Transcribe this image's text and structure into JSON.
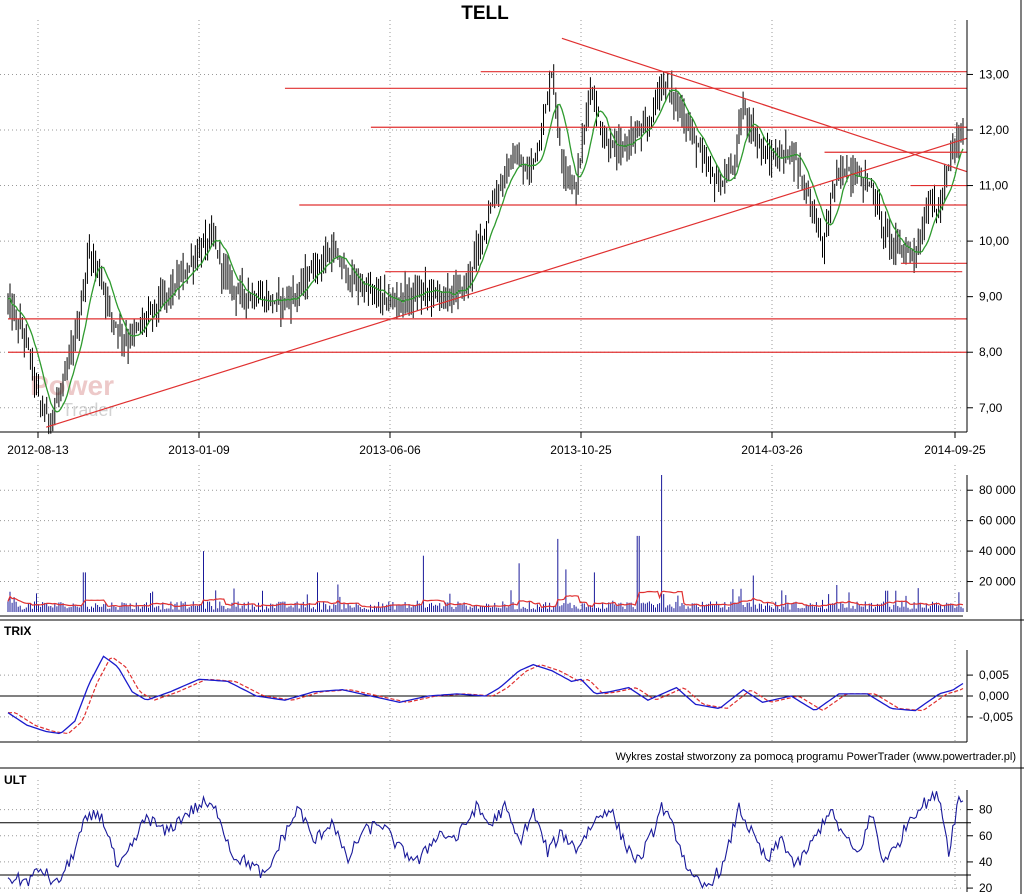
{
  "chart_data": [
    {
      "type": "candlestick",
      "title": "TELL",
      "x_ticks": [
        "2012-08-13",
        "2013-01-09",
        "2013-06-06",
        "2013-10-25",
        "2014-03-26",
        "2014-09-25"
      ],
      "y_ticks": [
        "7,00",
        "8,00",
        "9,00",
        "10,00",
        "11,00",
        "12,00",
        "13,00"
      ],
      "ylim": [
        6.6,
        13.8
      ],
      "grid": true,
      "price_path": [
        [
          0,
          8.9
        ],
        [
          0.02,
          8.2
        ],
        [
          0.035,
          7.0
        ],
        [
          0.045,
          6.8
        ],
        [
          0.06,
          7.5
        ],
        [
          0.075,
          8.6
        ],
        [
          0.085,
          9.8
        ],
        [
          0.095,
          9.5
        ],
        [
          0.11,
          8.6
        ],
        [
          0.125,
          8.2
        ],
        [
          0.14,
          8.5
        ],
        [
          0.16,
          8.9
        ],
        [
          0.18,
          9.3
        ],
        [
          0.2,
          9.8
        ],
        [
          0.215,
          10.1
        ],
        [
          0.225,
          9.5
        ],
        [
          0.24,
          9.1
        ],
        [
          0.26,
          9.0
        ],
        [
          0.28,
          8.9
        ],
        [
          0.3,
          9.0
        ],
        [
          0.32,
          9.5
        ],
        [
          0.34,
          9.8
        ],
        [
          0.36,
          9.3
        ],
        [
          0.38,
          9.1
        ],
        [
          0.4,
          8.9
        ],
        [
          0.42,
          9.0
        ],
        [
          0.44,
          9.1
        ],
        [
          0.46,
          9.0
        ],
        [
          0.48,
          9.2
        ],
        [
          0.495,
          10.0
        ],
        [
          0.51,
          10.8
        ],
        [
          0.53,
          11.5
        ],
        [
          0.545,
          11.2
        ],
        [
          0.56,
          12.0
        ],
        [
          0.57,
          13.1
        ],
        [
          0.58,
          11.5
        ],
        [
          0.595,
          10.9
        ],
        [
          0.61,
          12.8
        ],
        [
          0.625,
          11.8
        ],
        [
          0.64,
          11.6
        ],
        [
          0.655,
          11.9
        ],
        [
          0.67,
          12.0
        ],
        [
          0.685,
          12.9
        ],
        [
          0.7,
          12.5
        ],
        [
          0.715,
          12.0
        ],
        [
          0.73,
          11.4
        ],
        [
          0.745,
          11.0
        ],
        [
          0.76,
          11.3
        ],
        [
          0.77,
          12.4
        ],
        [
          0.78,
          12.0
        ],
        [
          0.795,
          11.5
        ],
        [
          0.81,
          11.5
        ],
        [
          0.82,
          11.7
        ],
        [
          0.835,
          11.0
        ],
        [
          0.845,
          10.5
        ],
        [
          0.855,
          9.9
        ],
        [
          0.865,
          11.0
        ],
        [
          0.875,
          11.3
        ],
        [
          0.89,
          11.2
        ],
        [
          0.905,
          11.0
        ],
        [
          0.915,
          10.3
        ],
        [
          0.93,
          9.9
        ],
        [
          0.945,
          9.8
        ],
        [
          0.955,
          9.9
        ],
        [
          0.965,
          10.8
        ],
        [
          0.975,
          10.5
        ],
        [
          0.99,
          11.7
        ],
        [
          1.0,
          11.9
        ]
      ],
      "support_resistance_lines": [
        {
          "y": 8.0,
          "x0": 0.0,
          "x1": 1.0
        },
        {
          "y": 8.6,
          "x0": 0.0,
          "x1": 1.0
        },
        {
          "y": 9.45,
          "x0": 0.395,
          "x1": 0.995
        },
        {
          "y": 9.6,
          "x0": 0.935,
          "x1": 1.0
        },
        {
          "y": 10.65,
          "x0": 0.305,
          "x1": 1.0
        },
        {
          "y": 11.0,
          "x0": 0.945,
          "x1": 1.0
        },
        {
          "y": 11.6,
          "x0": 0.855,
          "x1": 1.0
        },
        {
          "y": 12.05,
          "x0": 0.38,
          "x1": 1.0
        },
        {
          "y": 12.75,
          "x0": 0.29,
          "x1": 1.0
        },
        {
          "y": 13.05,
          "x0": 0.495,
          "x1": 1.0
        }
      ],
      "trend_lines": [
        {
          "x0": 0.04,
          "y0": 6.65,
          "x1": 1.0,
          "y1": 11.85
        },
        {
          "x0": 0.58,
          "y0": 13.65,
          "x1": 1.0,
          "y1": 11.25
        }
      ]
    },
    {
      "type": "bar",
      "series_name": "volume",
      "y_ticks": [
        "20 000",
        "40 000",
        "60 000",
        "80 000"
      ],
      "ylim": [
        0,
        90000
      ],
      "spikes": [
        [
          0.08,
          26000
        ],
        [
          0.205,
          40000
        ],
        [
          0.325,
          26000
        ],
        [
          0.435,
          37000
        ],
        [
          0.535,
          32000
        ],
        [
          0.575,
          48000
        ],
        [
          0.585,
          28000
        ],
        [
          0.615,
          26000
        ],
        [
          0.66,
          50000
        ],
        [
          0.685,
          90000
        ],
        [
          0.78,
          24000
        ],
        [
          0.92,
          14000
        ],
        [
          0.995,
          13000
        ]
      ]
    },
    {
      "type": "line",
      "label": "TRIX",
      "y_ticks": [
        "0,005",
        "0,000",
        "-0,005"
      ],
      "ylim": [
        -0.011,
        0.011
      ],
      "trix": [
        [
          0,
          -0.004
        ],
        [
          0.02,
          -0.007
        ],
        [
          0.04,
          -0.0085
        ],
        [
          0.055,
          -0.009
        ],
        [
          0.07,
          -0.006
        ],
        [
          0.085,
          0.003
        ],
        [
          0.1,
          0.0095
        ],
        [
          0.115,
          0.007
        ],
        [
          0.13,
          0.001
        ],
        [
          0.145,
          -0.001
        ],
        [
          0.17,
          0.001
        ],
        [
          0.2,
          0.004
        ],
        [
          0.23,
          0.0035
        ],
        [
          0.26,
          0.0
        ],
        [
          0.29,
          -0.001
        ],
        [
          0.32,
          0.001
        ],
        [
          0.35,
          0.0015
        ],
        [
          0.38,
          0.0
        ],
        [
          0.41,
          -0.0015
        ],
        [
          0.44,
          0.0
        ],
        [
          0.47,
          0.0005
        ],
        [
          0.5,
          0.0
        ],
        [
          0.515,
          0.002
        ],
        [
          0.535,
          0.006
        ],
        [
          0.55,
          0.0075
        ],
        [
          0.57,
          0.006
        ],
        [
          0.59,
          0.0035
        ],
        [
          0.6,
          0.004
        ],
        [
          0.615,
          0.0005
        ],
        [
          0.63,
          0.001
        ],
        [
          0.65,
          0.002
        ],
        [
          0.67,
          -0.001
        ],
        [
          0.7,
          0.002
        ],
        [
          0.72,
          -0.002
        ],
        [
          0.745,
          -0.003
        ],
        [
          0.77,
          0.0015
        ],
        [
          0.79,
          -0.0015
        ],
        [
          0.82,
          0.0
        ],
        [
          0.845,
          -0.0035
        ],
        [
          0.87,
          0.0005
        ],
        [
          0.9,
          0.0005
        ],
        [
          0.925,
          -0.003
        ],
        [
          0.95,
          -0.0035
        ],
        [
          0.975,
          0.0005
        ],
        [
          0.99,
          0.0015
        ],
        [
          1.0,
          0.003
        ]
      ]
    },
    {
      "type": "line",
      "label": "ULT",
      "y_ticks": [
        "80",
        "60",
        "40",
        "20"
      ],
      "ylim": [
        17,
        95
      ],
      "reference_lines": [
        70,
        30
      ],
      "ult": [
        [
          0,
          28
        ],
        [
          0.02,
          25
        ],
        [
          0.035,
          35
        ],
        [
          0.05,
          22
        ],
        [
          0.065,
          40
        ],
        [
          0.08,
          70
        ],
        [
          0.095,
          78
        ],
        [
          0.105,
          62
        ],
        [
          0.115,
          33
        ],
        [
          0.13,
          52
        ],
        [
          0.145,
          75
        ],
        [
          0.165,
          62
        ],
        [
          0.185,
          76
        ],
        [
          0.205,
          85
        ],
        [
          0.22,
          78
        ],
        [
          0.235,
          45
        ],
        [
          0.255,
          38
        ],
        [
          0.27,
          28
        ],
        [
          0.285,
          55
        ],
        [
          0.305,
          82
        ],
        [
          0.32,
          55
        ],
        [
          0.34,
          72
        ],
        [
          0.355,
          40
        ],
        [
          0.37,
          62
        ],
        [
          0.39,
          70
        ],
        [
          0.41,
          50
        ],
        [
          0.43,
          40
        ],
        [
          0.45,
          62
        ],
        [
          0.47,
          58
        ],
        [
          0.49,
          82
        ],
        [
          0.505,
          68
        ],
        [
          0.52,
          82
        ],
        [
          0.535,
          55
        ],
        [
          0.55,
          78
        ],
        [
          0.565,
          48
        ],
        [
          0.58,
          62
        ],
        [
          0.595,
          50
        ],
        [
          0.615,
          72
        ],
        [
          0.63,
          82
        ],
        [
          0.645,
          55
        ],
        [
          0.66,
          40
        ],
        [
          0.675,
          62
        ],
        [
          0.685,
          83
        ],
        [
          0.7,
          60
        ],
        [
          0.715,
          28
        ],
        [
          0.73,
          20
        ],
        [
          0.75,
          38
        ],
        [
          0.765,
          82
        ],
        [
          0.78,
          60
        ],
        [
          0.795,
          40
        ],
        [
          0.81,
          58
        ],
        [
          0.825,
          36
        ],
        [
          0.845,
          58
        ],
        [
          0.86,
          80
        ],
        [
          0.875,
          60
        ],
        [
          0.89,
          45
        ],
        [
          0.905,
          78
        ],
        [
          0.915,
          42
        ],
        [
          0.93,
          50
        ],
        [
          0.945,
          75
        ],
        [
          0.96,
          85
        ],
        [
          0.975,
          92
        ],
        [
          0.985,
          48
        ],
        [
          0.995,
          88
        ],
        [
          1.0,
          86
        ]
      ]
    }
  ],
  "credit": "Wykres został stworzony za pomocą programu PowerTrader (www.powertrader.pl)",
  "watermark": {
    "line1": "Power",
    "line2": "Trader"
  },
  "colors": {
    "candles": "#000000",
    "moving_average": "#2f9b2f",
    "sr_lines": "#e03030",
    "volume_bars": "#1a1a9a",
    "volume_average": "#e03030",
    "trix": "#1a1acc",
    "trix_signal": "#e03030",
    "ult": "#1a1a9a"
  }
}
